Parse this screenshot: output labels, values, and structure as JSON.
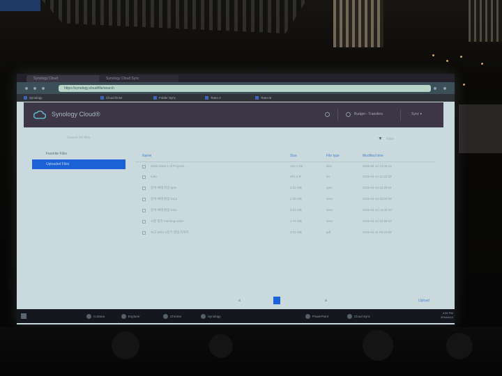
{
  "browser": {
    "tabs": [
      "Synology Cloud",
      "Synology Cloud Sync"
    ],
    "url": "https://synology.cloud/file/search",
    "bookmarks": [
      "Synology",
      "Cloud Drive",
      "Folder Sync",
      "Team A",
      "Team B"
    ]
  },
  "header": {
    "title": "Synology Cloud®",
    "user": "Budget - Transfers",
    "menu": "Sync ▾"
  },
  "search": {
    "placeholder": "Search for files",
    "filter_label": "Filter"
  },
  "sidebar": {
    "items": [
      {
        "label": "Favorite Files"
      },
      {
        "label": "Uploaded Files"
      }
    ]
  },
  "table": {
    "columns": [
      "Name",
      "Size",
      "File type",
      "Modified time"
    ],
    "rows": [
      {
        "name": "2016 sheet 1 of Projects",
        "size": "182.1 KB",
        "type": "xlsx",
        "modified": "2016-04-14 12:45:12"
      },
      {
        "name": "todo",
        "size": "491.2 B",
        "type": "txt",
        "modified": "2016-04-14 11:02:33"
      },
      {
        "name": "문서 예제 파일.pptx",
        "size": "2.21 MB",
        "type": "pptx",
        "modified": "2016-04-13 15:20:41"
      },
      {
        "name": "문서 예제 편집 0112",
        "size": "2.25 MB",
        "type": "docx",
        "modified": "2016-04-13 15:09:08"
      },
      {
        "name": "문서 예제 편집 0111",
        "size": "3.03 MB",
        "type": "docx",
        "modified": "2016-04-12 16:48:10"
      },
      {
        "name": "사진 정리 meeting notes",
        "size": "1.71 MB",
        "type": "docx",
        "modified": "2016-04-12 10:55:23"
      },
      {
        "name": "보고 2016 1분기 영업 리포트",
        "size": "3.21 MB",
        "type": "pdf",
        "modified": "2016-04-11 09:24:09"
      }
    ]
  },
  "footer": {
    "page": "1",
    "link": "Upload"
  },
  "taskbar": {
    "items": [
      "Cortana",
      "Explorer",
      "Chrome",
      "Synology",
      "PowerPoint",
      "Cloud Sync"
    ],
    "time": "4:52 PM",
    "date": "2016/4/14"
  },
  "colors": {
    "accent": "#1c62d6",
    "header": "#3c3646",
    "screen": "#c9d9dd"
  },
  "icons": [
    "cloud-logo-icon",
    "search-icon",
    "filter-icon",
    "file-icon",
    "windows-start-icon"
  ]
}
